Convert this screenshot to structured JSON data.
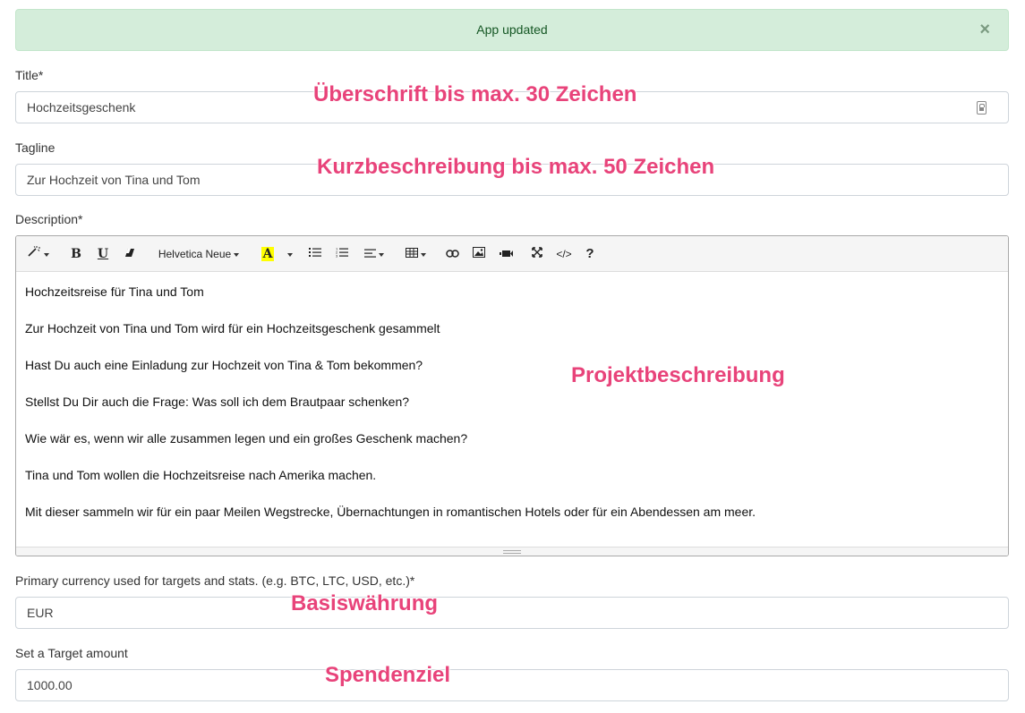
{
  "alert": {
    "message": "App updated",
    "close": "×"
  },
  "title": {
    "label": "Title*",
    "value": "Hochzeitsgeschenk",
    "annotation": "Überschrift bis max. 30 Zeichen"
  },
  "tagline": {
    "label": "Tagline",
    "value": "Zur Hochzeit von Tina und Tom",
    "annotation": "Kurzbeschreibung bis max. 50 Zeichen"
  },
  "description": {
    "label": "Description*",
    "annotation": "Projektbeschreibung",
    "toolbar": {
      "bold": "B",
      "underline": "U",
      "font": "Helvetica Neue",
      "color": "A",
      "code": "</>",
      "help": "?"
    },
    "paragraphs": [
      "Hochzeitsreise für Tina und Tom",
      "Zur Hochzeit von Tina und Tom wird für ein Hochzeitsgeschenk gesammelt",
      "Hast Du auch eine Einladung zur Hochzeit von Tina & Tom bekommen?",
      "Stellst Du Dir auch die Frage: Was soll ich dem Brautpaar schenken?",
      "Wie wär es, wenn wir alle zusammen legen und ein großes Geschenk machen?",
      "Tina und Tom wollen die Hochzeitsreise nach Amerika machen.",
      "Mit dieser sammeln wir für ein paar Meilen Wegstrecke, Übernachtungen in romantischen Hotels oder für ein Abendessen am meer."
    ]
  },
  "currency": {
    "label": "Primary currency used for targets and stats. (e.g. BTC, LTC, USD, etc.)*",
    "value": "EUR",
    "annotation": "Basiswährung"
  },
  "target": {
    "label": "Set a Target amount",
    "value": "1000.00",
    "annotation": "Spendenziel"
  }
}
